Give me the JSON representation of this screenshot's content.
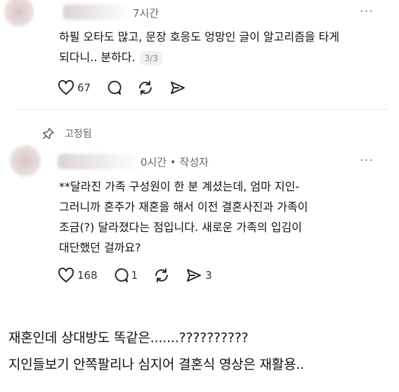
{
  "comment1": {
    "time_suffix": "7시간",
    "body_lines": [
      "하필 오타도 많고, 문장 호응도 엉망인 글이 알고리즘을 타게",
      "되다니.. 분하다."
    ],
    "page_badge": "3/3",
    "like_count": "67",
    "more": "···"
  },
  "pinned_label": "고정됨",
  "comment2": {
    "time_suffix": "0시간 • 작성자",
    "body_lines": [
      "**달라진 가족 구성원이 한 분 계셨는데, 엄마 지인-",
      "그러니까 혼주가 재혼을 해서 이전 결혼사진과 가족이",
      "조금(?) 달라졌다는 점입니다. 새로운 가족의 입김이",
      "대단했던 걸까요?"
    ],
    "like_count": "168",
    "reply_count": "1",
    "share_count": "3",
    "more": "···"
  },
  "caption_lines": [
    "재혼인데 상대방도 똑같은.......??????????",
    "지인들보기 안쪽팔리나 심지어 결혼식 영상은 재활용.."
  ]
}
